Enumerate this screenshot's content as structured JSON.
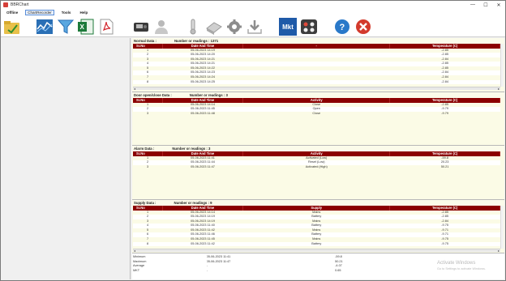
{
  "window": {
    "title": "BBRChart",
    "minimize": "—",
    "maximize": "☐",
    "close": "✕"
  },
  "menu": [
    {
      "label": "Offline",
      "active": false
    },
    {
      "label": "ChartRecorder",
      "active": true
    },
    {
      "label": "Tools",
      "active": false
    },
    {
      "label": "Help",
      "active": false
    }
  ],
  "toolbar": {
    "mkt_label": "Mkt"
  },
  "normal": {
    "title": "Normal Data :",
    "count": "Number or readings : 1371",
    "headers": [
      "Sr.No",
      "Date And Time",
      "-",
      "Temperature (C)"
    ],
    "rows": [
      [
        "1",
        "05-06-2023 14:19",
        "",
        "-2.85"
      ],
      [
        "2",
        "05-06-2023 14:20",
        "",
        "-2.85"
      ],
      [
        "3",
        "05-06-2023 14:21",
        "",
        "-2.84"
      ],
      [
        "4",
        "05-06-2023 14:21",
        "",
        "-2.85"
      ],
      [
        "5",
        "05-06-2023 14:22",
        "",
        "-2.85"
      ],
      [
        "6",
        "05-06-2023 14:23",
        "",
        "-2.84"
      ],
      [
        "7",
        "05-06-2023 14:24",
        "",
        "-2.84"
      ],
      [
        "8",
        "05-06-2023 14:25",
        "",
        "-2.84"
      ]
    ]
  },
  "door": {
    "title": "Door open/close Data :",
    "count": "Number or readings : 3",
    "headers": [
      "Sr.No",
      "Date And Time",
      "Activity",
      "Temperature (C)"
    ],
    "rows": [
      [
        "1",
        "05-06-2023 14:14",
        "Close",
        "-2.85"
      ],
      [
        "2",
        "05-06-2023 11:45",
        "Open",
        "-9.79"
      ],
      [
        "3",
        "05-06-2023 11:48",
        "Close",
        "-9.79"
      ]
    ]
  },
  "alarm": {
    "title": "Alarm Data :",
    "count": "Number or readings : 3",
    "headers": [
      "Sr.No",
      "Date And Time",
      "Activity",
      "Temperature (C)"
    ],
    "rows": [
      [
        "1",
        "05-06-2023 11:41",
        "Activated (Low)",
        "-59.8"
      ],
      [
        "2",
        "05-06-2023 11:44",
        "Reset (Low)",
        "20.23"
      ],
      [
        "3",
        "05-06-2023 11:47",
        "Activated (High)",
        "50.21"
      ]
    ]
  },
  "supply": {
    "title": "Supply Data :",
    "count": "Number or readings : 9",
    "headers": [
      "Sr.No",
      "Date And Time",
      "Supply",
      "Temperature (C)"
    ],
    "rows": [
      [
        "1",
        "05-06-2023 14:14",
        "Mains",
        "-2.85"
      ],
      [
        "2",
        "05-06-2023 14:19",
        "Battery",
        "-2.85"
      ],
      [
        "3",
        "05-06-2023 14:19",
        "Mains",
        "-2.84"
      ],
      [
        "4",
        "05-06-2023 11:40",
        "Battery",
        "-9.75"
      ],
      [
        "5",
        "05-06-2023 11:42",
        "Mains",
        "-9.71"
      ],
      [
        "6",
        "05-06-2023 11:46",
        "Battery",
        "-9.71"
      ],
      [
        "7",
        "05-06-2023 11:45",
        "Mains",
        "-9.75"
      ],
      [
        "8",
        "05-06-2023 11:42",
        "Battery",
        "-9.75"
      ]
    ]
  },
  "summary": {
    "rows": [
      [
        "Minimum",
        "05-06-2023 11:41",
        "-59.8"
      ],
      [
        "Maximum",
        "05-06-2023 11:47",
        "50.21"
      ],
      [
        "Average",
        "-",
        "-4.07"
      ],
      [
        "MKT",
        "-",
        "0.65"
      ]
    ]
  },
  "watermark": {
    "line1": "Activate Windows",
    "line2": "Go to Settings to activate Windows."
  }
}
